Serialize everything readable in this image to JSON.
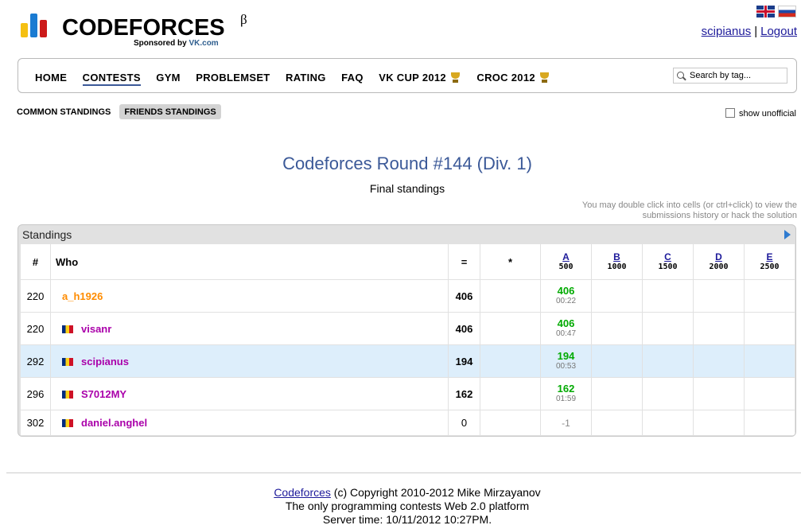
{
  "logo": {
    "text": "CODEFORCES",
    "beta": "β",
    "sponsor_prefix": "Sponsored by",
    "sponsor_name": "VK.com",
    "bar_colors": [
      "#f5c012",
      "#1a7bd2",
      "#cc1a1a"
    ]
  },
  "user": {
    "name": "scipianus",
    "separator": "|",
    "logout": "Logout"
  },
  "menu": {
    "items": [
      {
        "label": "HOME"
      },
      {
        "label": "CONTESTS",
        "active": true
      },
      {
        "label": "GYM"
      },
      {
        "label": "PROBLEMSET"
      },
      {
        "label": "RATING"
      },
      {
        "label": "FAQ"
      },
      {
        "label": "VK CUP 2012",
        "icon": "trophy-icon"
      },
      {
        "label": "CROC 2012",
        "icon": "trophy-icon"
      }
    ],
    "search_placeholder": "Search by tag..."
  },
  "tabs": {
    "common": "COMMON STANDINGS",
    "friends": "FRIENDS STANDINGS"
  },
  "show_unofficial": "show unofficial",
  "contest": {
    "title": "Codeforces Round #144 (Div. 1)",
    "subtitle": "Final standings",
    "hint_line1": "You may double click into cells (or ctrl+click) to view the",
    "hint_line2": "submissions history or hack the solution"
  },
  "standings": {
    "panel_title": "Standings",
    "headers": {
      "rank": "#",
      "who": "Who",
      "points": "=",
      "penalty": "*"
    },
    "problems": [
      {
        "label": "A",
        "points": "500"
      },
      {
        "label": "B",
        "points": "1000"
      },
      {
        "label": "C",
        "points": "1500"
      },
      {
        "label": "D",
        "points": "2000"
      },
      {
        "label": "E",
        "points": "2500"
      }
    ],
    "rows": [
      {
        "rank": "220",
        "name": "a_h1926",
        "points": "406",
        "a_score": "406",
        "a_time": "00:22"
      },
      {
        "rank": "220",
        "name": "visanr",
        "points": "406",
        "a_score": "406",
        "a_time": "00:47"
      },
      {
        "rank": "292",
        "name": "scipianus",
        "points": "194",
        "a_score": "194",
        "a_time": "00:53"
      },
      {
        "rank": "296",
        "name": "S7012MY",
        "points": "162",
        "a_score": "162",
        "a_time": "01:59"
      },
      {
        "rank": "302",
        "name": "daniel.anghel",
        "points": "0",
        "a_score": "-1",
        "a_time": ""
      }
    ]
  },
  "footer": {
    "link": "Codeforces",
    "copyright": " (c) Copyright 2010-2012 Mike Mirzayanov",
    "line2": "The only programming contests Web 2.0 platform",
    "line3": "Server time: 10/11/2012 10:27PM."
  }
}
